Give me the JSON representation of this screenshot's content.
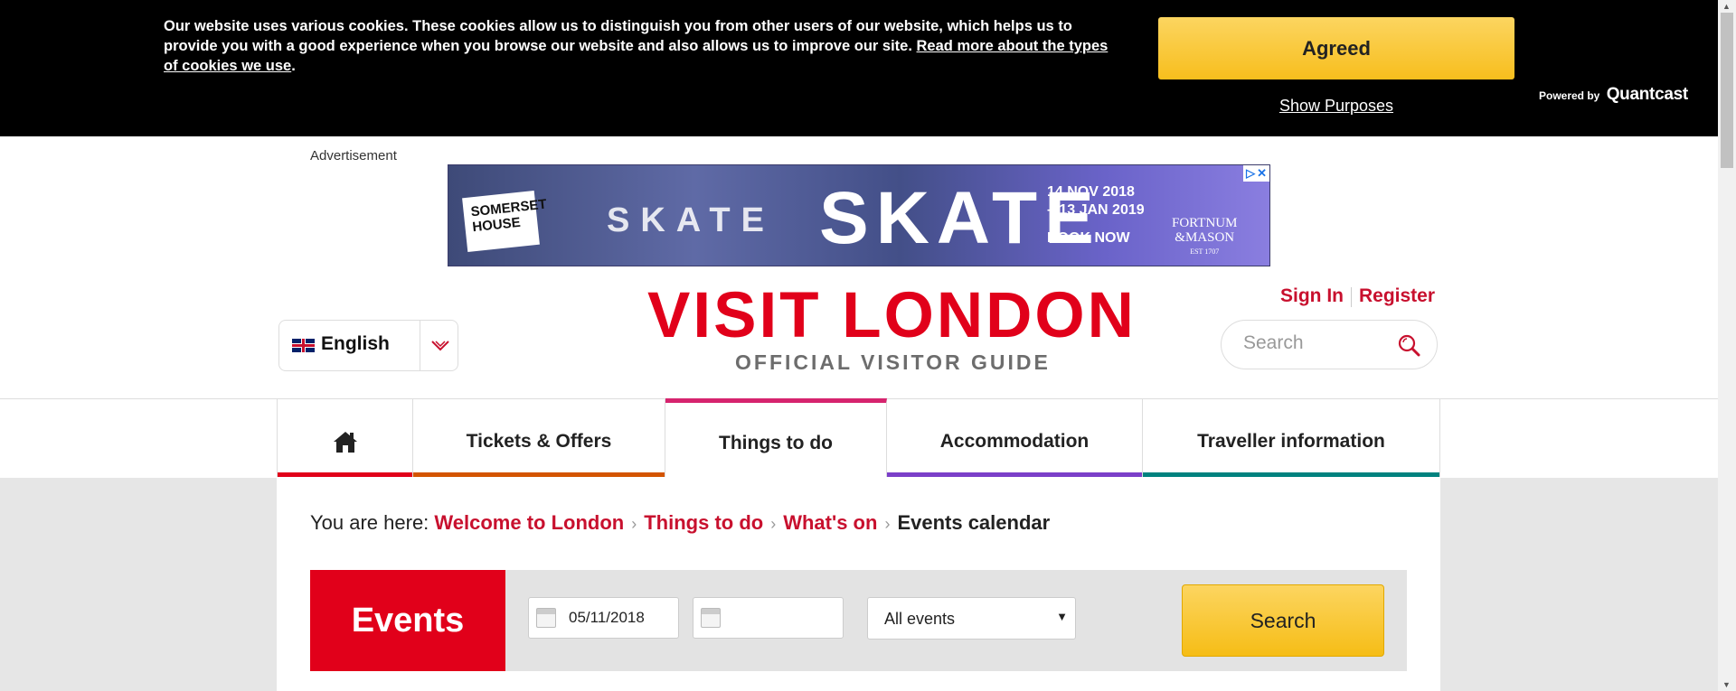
{
  "cookie_banner": {
    "text": "Our website uses various cookies. These cookies allow us to distinguish you from other users of our website, which helps us to provide you with a good experience when you browse our website and also allows us to improve our site.",
    "link_text": "Read more about the types of cookies we use",
    "period": ".",
    "agree_label": "Agreed",
    "show_purposes_label": "Show Purposes",
    "powered_by": "Powered by",
    "powered_brand": "Quantcast"
  },
  "advertisement": {
    "label": "Advertisement",
    "brand_left": "SOMERSET HOUSE",
    "headline_small": "SKATE",
    "headline": "SKATE",
    "dates_line1": "14 NOV 2018",
    "dates_line2": "– 13 JAN 2019",
    "cta": "BOOK NOW",
    "sponsor_line1": "FORTNUM",
    "sponsor_line2": "&MASON",
    "sponsor_est": "EST 1707"
  },
  "header": {
    "language": "English",
    "logo_title": "VISIT LONDON",
    "logo_subtitle": "OFFICIAL VISITOR GUIDE",
    "sign_in": "Sign In",
    "register": "Register",
    "search_placeholder": "Search"
  },
  "nav": {
    "items": [
      {
        "label": "",
        "icon": "home-icon",
        "color": "#e1001a"
      },
      {
        "label": "Tickets & Offers",
        "color": "#d35400"
      },
      {
        "label": "Things to do",
        "color": "#d6246e",
        "active": true
      },
      {
        "label": "Accommodation",
        "color": "#7b3fc9"
      },
      {
        "label": "Traveller information",
        "color": "#00827f"
      }
    ]
  },
  "breadcrumb": {
    "prefix": "You are here:",
    "items": [
      "Welcome to London",
      "Things to do",
      "What's on"
    ],
    "current": "Events calendar"
  },
  "events_search": {
    "title": "Events",
    "date_from": "05/11/2018",
    "date_to": "",
    "category": "All events",
    "search_label": "Search"
  },
  "colors": {
    "brand_red": "#e1001a",
    "link_red": "#c8102e",
    "button_yellow": "#f7be1d"
  }
}
